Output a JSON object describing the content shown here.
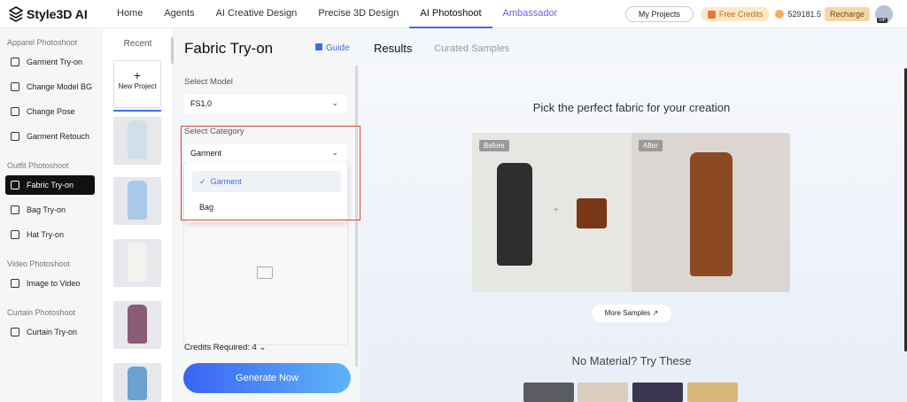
{
  "app": {
    "name": "Style3D AI"
  },
  "nav": {
    "items": [
      {
        "label": "Home"
      },
      {
        "label": "Agents"
      },
      {
        "label": "AI Creative Design"
      },
      {
        "label": "Precise 3D Design"
      },
      {
        "label": "AI Photoshoot"
      },
      {
        "label": "Ambassador"
      }
    ],
    "active": "AI Photoshoot"
  },
  "header": {
    "my_projects": "My Projects",
    "free_credits": "Free Credits",
    "credits_value": "529181.5",
    "recharge": "Recharge",
    "vip": "VIP"
  },
  "sidebar": {
    "sections": [
      {
        "title": "Apparel Photoshoot",
        "items": [
          "Garment Try-on",
          "Change Model BG",
          "Change Pose",
          "Garment Retouch"
        ]
      },
      {
        "title": "Outfit Photoshoot",
        "items": [
          "Fabric Try-on",
          "Bag Try-on",
          "Hat Try-on"
        ]
      },
      {
        "title": "Video Photoshoot",
        "items": [
          "Image to Video"
        ]
      },
      {
        "title": "Curtain Photoshoot",
        "items": [
          "Curtain Try-on"
        ]
      }
    ],
    "active": "Fabric Try-on"
  },
  "recent": {
    "title": "Recent",
    "new_project": "New Project"
  },
  "panel": {
    "title": "Fabric Try-on",
    "guide": "Guide",
    "select_model_label": "Select Model",
    "select_model_value": "FS1.0",
    "select_category_label": "Select Category",
    "select_category_value": "Garment",
    "category_options": [
      "Garment",
      "Bag"
    ],
    "credits_required": "Credits Required: 4",
    "generate": "Generate Now"
  },
  "main": {
    "tabs": [
      "Results",
      "Curated Samples"
    ],
    "heading": "Pick the perfect fabric for your creation",
    "before_tag": "Before",
    "after_tag": "After",
    "more_samples": "More Samples",
    "no_material": "No Material? Try These"
  },
  "colors": {
    "accent": "#3b6cf6",
    "highlight_box": "#e0443a",
    "ambassador": "#6a5cf0"
  }
}
